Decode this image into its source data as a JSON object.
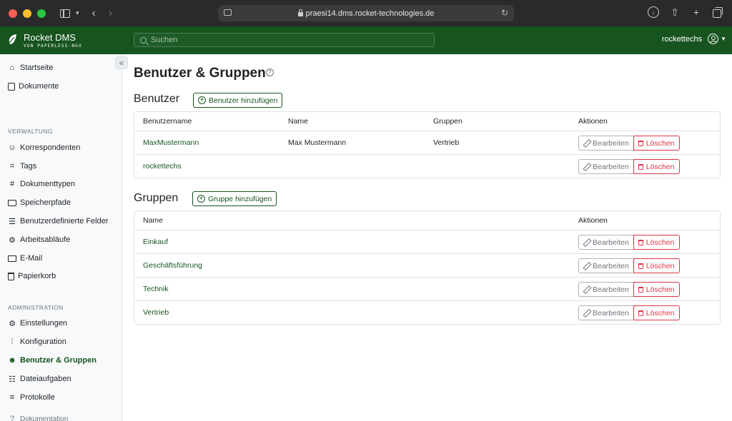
{
  "browser": {
    "url": "praesi14.dms.rocket-technologies.de"
  },
  "app": {
    "brand_title": "Rocket DMS",
    "brand_subtitle": "VON PAPERLESS-NGX",
    "search_placeholder": "Suchen",
    "username": "rockettechs",
    "accent_color": "#17541f"
  },
  "sidebar": {
    "top_items": [
      {
        "label": "Startseite",
        "icon": "house-icon"
      },
      {
        "label": "Dokumente",
        "icon": "documents-icon"
      }
    ],
    "section_management": "VERWALTUNG",
    "management_items": [
      {
        "label": "Korrespondenten",
        "icon": "person-icon"
      },
      {
        "label": "Tags",
        "icon": "tag-icon"
      },
      {
        "label": "Dokumenttypen",
        "icon": "hash-icon"
      },
      {
        "label": "Speicherpfade",
        "icon": "folder-icon"
      },
      {
        "label": "Benutzerdefinierte Felder",
        "icon": "fields-icon"
      },
      {
        "label": "Arbeitsabläufe",
        "icon": "workflow-icon"
      },
      {
        "label": "E-Mail",
        "icon": "mail-icon"
      },
      {
        "label": "Papierkorb",
        "icon": "trash-icon"
      }
    ],
    "section_admin": "ADMINISTRATION",
    "admin_items": [
      {
        "label": "Einstellungen",
        "icon": "gear-icon"
      },
      {
        "label": "Konfiguration",
        "icon": "sliders-icon"
      },
      {
        "label": "Benutzer & Gruppen",
        "icon": "people-icon",
        "active": true
      },
      {
        "label": "Dateiaufgaben",
        "icon": "list-icon"
      },
      {
        "label": "Protokolle",
        "icon": "text-lines-icon"
      }
    ],
    "bottom_item": "Dokumentation"
  },
  "main": {
    "page_title": "Benutzer & Gruppen",
    "users": {
      "title": "Benutzer",
      "add_label": "Benutzer hinzufügen",
      "columns": [
        "Benutzername",
        "Name",
        "Gruppen",
        "Aktionen"
      ],
      "rows": [
        {
          "username": "MaxMustermann",
          "name": "Max Mustermann",
          "groups": "Vertrieb"
        },
        {
          "username": "rockettechs",
          "name": "",
          "groups": ""
        }
      ]
    },
    "groups": {
      "title": "Gruppen",
      "add_label": "Gruppe hinzufügen",
      "columns": [
        "Name",
        "Aktionen"
      ],
      "rows": [
        {
          "name": "Einkauf"
        },
        {
          "name": "Geschäftsführung"
        },
        {
          "name": "Technik"
        },
        {
          "name": "Vertrieb"
        }
      ]
    },
    "edit_label": "Bearbeiten",
    "delete_label": "Löschen"
  }
}
